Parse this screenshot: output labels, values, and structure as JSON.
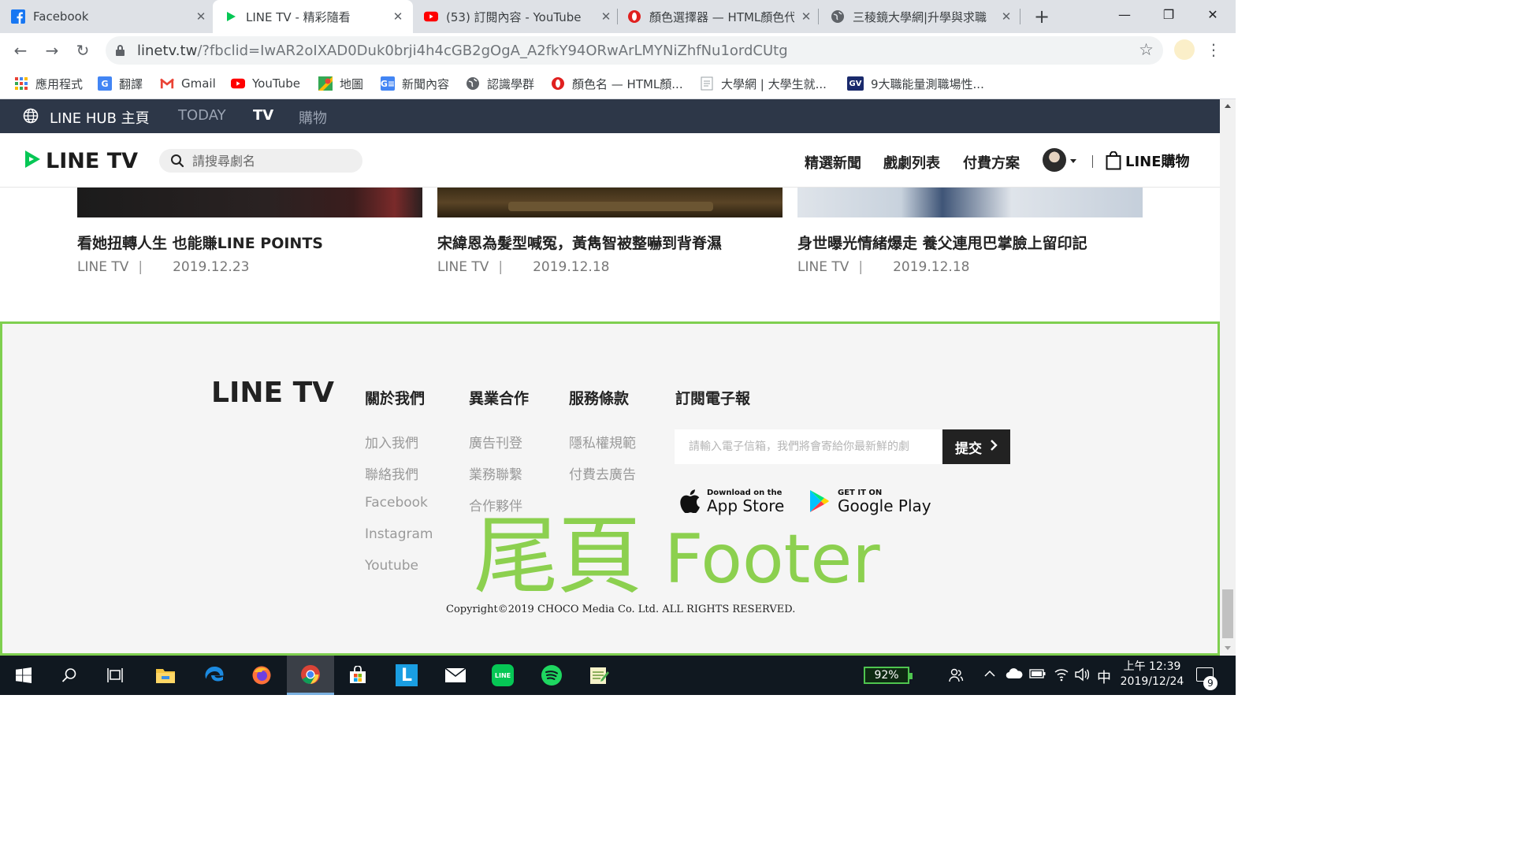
{
  "browser": {
    "tabs": [
      {
        "title": "Facebook",
        "active": false
      },
      {
        "title": "LINE TV - 精彩隨看",
        "active": true
      },
      {
        "title": "(53) 訂閱內容 - YouTube",
        "active": false
      },
      {
        "title": "顏色選擇器 — HTML顏色代",
        "active": false
      },
      {
        "title": "三稜鏡大學網|升學與求職",
        "active": false
      }
    ],
    "url_host": "linetv.tw",
    "url_rest": "/?fbclid=IwAR2oIXAD0Duk0brji4h4cGB2gOgA_A2fkY94ORwArLMYNiZhfNu1ordCUtg",
    "bookmarks": [
      {
        "label": "應用程式",
        "icon": "apps-grid-icon"
      },
      {
        "label": "翻譯",
        "icon": "google-translate-icon"
      },
      {
        "label": "Gmail",
        "icon": "gmail-icon"
      },
      {
        "label": "YouTube",
        "icon": "youtube-icon"
      },
      {
        "label": "地圖",
        "icon": "maps-icon"
      },
      {
        "label": "新聞內容",
        "icon": "google-news-icon"
      },
      {
        "label": "認識學群",
        "icon": "globe-icon"
      },
      {
        "label": "顏色名 — HTML顏...",
        "icon": "opera-icon"
      },
      {
        "label": "大學網 | 大學生就...",
        "icon": "document-icon"
      },
      {
        "label": "9大職能量測職場性...",
        "icon": "gv-icon"
      }
    ]
  },
  "hub_nav": {
    "home": "LINE HUB 主頁",
    "items": [
      "TODAY",
      "TV",
      "購物"
    ]
  },
  "tv_header": {
    "logo": "LINE TV",
    "search_placeholder": "請搜尋劇名",
    "links": [
      "精選新聞",
      "戲劇列表",
      "付費方案"
    ],
    "shop_label": "LINE購物"
  },
  "articles": [
    {
      "title": "看她扭轉人生 也能賺LINE POINTS",
      "source": "LINE TV",
      "date": "2019.12.23"
    },
    {
      "title": "宋緯恩為髮型喊冤，黃雋智被整嚇到背脊濕",
      "source": "LINE TV",
      "date": "2019.12.18"
    },
    {
      "title": "身世曝光情緒爆走 養父連甩巴掌臉上留印記",
      "source": "LINE TV",
      "date": "2019.12.18"
    }
  ],
  "footer": {
    "logo": "LINE TV",
    "columns": [
      {
        "heading": "關於我們",
        "links": [
          "加入我們",
          "聯絡我們",
          "Facebook",
          "Instagram",
          "Youtube"
        ]
      },
      {
        "heading": "異業合作",
        "links": [
          "廣告刊登",
          "業務聯繫",
          "合作夥伴"
        ]
      },
      {
        "heading": "服務條款",
        "links": [
          "隱私權規範",
          "付費去廣告"
        ]
      }
    ],
    "newsletter_heading": "訂閱電子報",
    "email_placeholder": "請輸入電子信箱，我們將會寄給你最新鮮的劇",
    "submit_label": "提交",
    "app_store": {
      "small": "Download on the",
      "big": "App Store"
    },
    "google_play": {
      "small": "GET IT ON",
      "big": "Google Play"
    },
    "overlay_zh": "尾頁",
    "overlay_en": "Footer",
    "copyright": "Copyright©2019 CHOCO Media Co. Ltd. ALL RIGHTS RESERVED."
  },
  "taskbar": {
    "battery": "92%",
    "ime": "中",
    "time": "上午 12:39",
    "date": "2019/12/24",
    "notification_count": "9"
  },
  "colors": {
    "hub_nav_bg": "#2d3748",
    "line_green": "#06c755",
    "footer_border": "#7fcf4f",
    "footer_overlay": "#8cd04f"
  }
}
